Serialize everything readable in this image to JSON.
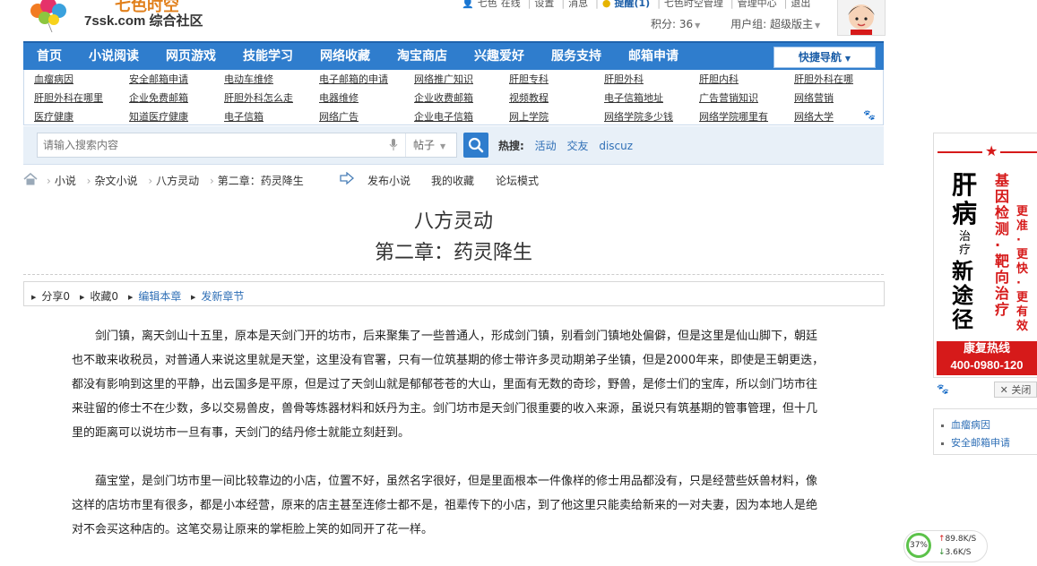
{
  "header": {
    "brand_top": "七色时空",
    "site_name": "7ssk.com 综合社区",
    "user_links": [
      "七色",
      "在线",
      "设置",
      "消息",
      "提醒(1)",
      "七色时空管理",
      "管理中心",
      "退出"
    ],
    "points": "积分: 36",
    "user_group": "用户组: 超级版主"
  },
  "nav": {
    "items": [
      "首页",
      "小说阅读",
      "网页游戏",
      "技能学习",
      "网络收藏",
      "淘宝商店",
      "兴趣爱好",
      "服务支持",
      "邮箱申请"
    ],
    "quick_nav": "快捷导航"
  },
  "links": {
    "rows": [
      [
        "血瘤病因",
        "安全邮箱申请",
        "电动车维修",
        "电子邮箱的申请",
        "网络推广知识",
        "肝胆专科",
        "肝胆外科",
        "肝胆内科",
        "肝胆外科在哪"
      ],
      [
        "肝胆外科在哪里",
        "企业免费邮箱",
        "肝胆外科怎么走",
        "电器维修",
        "企业收费邮箱",
        "视频教程",
        "电子信箱地址",
        "广告营销知识",
        "网络营销"
      ],
      [
        "医疗健康",
        "知道医疗健康",
        "电子信箱",
        "网络广告",
        "企业电子信箱",
        "网上学院",
        "网络学院多少钱",
        "网络学院哪里有",
        "网络大学"
      ]
    ]
  },
  "search": {
    "placeholder": "请输入搜索内容",
    "type": "帖子",
    "hot_label": "热搜:",
    "hot_terms": [
      "活动",
      "交友",
      "discuz"
    ]
  },
  "breadcrumb": [
    "小说",
    "杂文小说",
    "八方灵动",
    "第二章：药灵降生"
  ],
  "actions": [
    "发布小说",
    "我的收藏",
    "论坛模式"
  ],
  "book": {
    "title": "八方灵动",
    "chapter": "第二章：药灵降生"
  },
  "toolbar": {
    "share": "分享0",
    "collect": "收藏0",
    "edit": "编辑本章",
    "new_chapter": "发新章节"
  },
  "content": {
    "paragraphs": [
      "剑门镇，离天剑山十五里，原本是天剑门开的坊市，后来聚集了一些普通人，形成剑门镇，别看剑门镇地处偏僻，但是这里是仙山脚下，朝廷也不敢来收税员，对普通人来说这里就是天堂，这里没有官署，只有一位筑基期的修士带许多灵动期弟子坐镇，但是2000年来，即使是王朝更迭，都没有影响到这里的平静，出云国多是平原，但是过了天剑山就是郁郁苍苍的大山，里面有无数的奇珍，野兽，是修士们的宝库，所以剑门坊市往来驻留的修士不在少数，多以交易兽皮，兽骨等炼器材料和妖丹为主。剑门坊市是天剑门很重要的收入来源，虽说只有筑基期的管事管理，但十几里的距离可以说坊市一旦有事，天剑门的结丹修士就能立刻赶到。",
      "蕴宝堂，是剑门坊市里一间比较靠边的小店，位置不好，虽然名字很好，但是里面根本一件像样的修士用品都没有，只是经营些妖兽材料，像这样的店坊市里有很多，都是小本经营，原来的店主甚至连修士都不是，祖辈传下的小店，到了他这里只能卖给新来的一对夫妻，因为本地人是绝对不会买这种店的。这笔交易让原来的掌柜脸上笑的如同开了花一样。"
    ]
  },
  "ad": {
    "big1": "肝病",
    "small": "治疗",
    "big2": "新途径",
    "red1": "基因检测·靶向治疗",
    "red2": "更准·更快·更有效",
    "hotline_label": "康复热线",
    "hotline_number": "400-0980-120",
    "close": "✕ 关闭"
  },
  "side_links": [
    "血瘤病因",
    "安全邮箱申请"
  ],
  "speed": {
    "percent": "37%",
    "up": "89.8K/S",
    "down": "3.6K/S"
  },
  "colors": {
    "nav_blue": "#2f7dcd",
    "link_blue": "#2f6fb6",
    "ad_red": "#d61a1a"
  }
}
